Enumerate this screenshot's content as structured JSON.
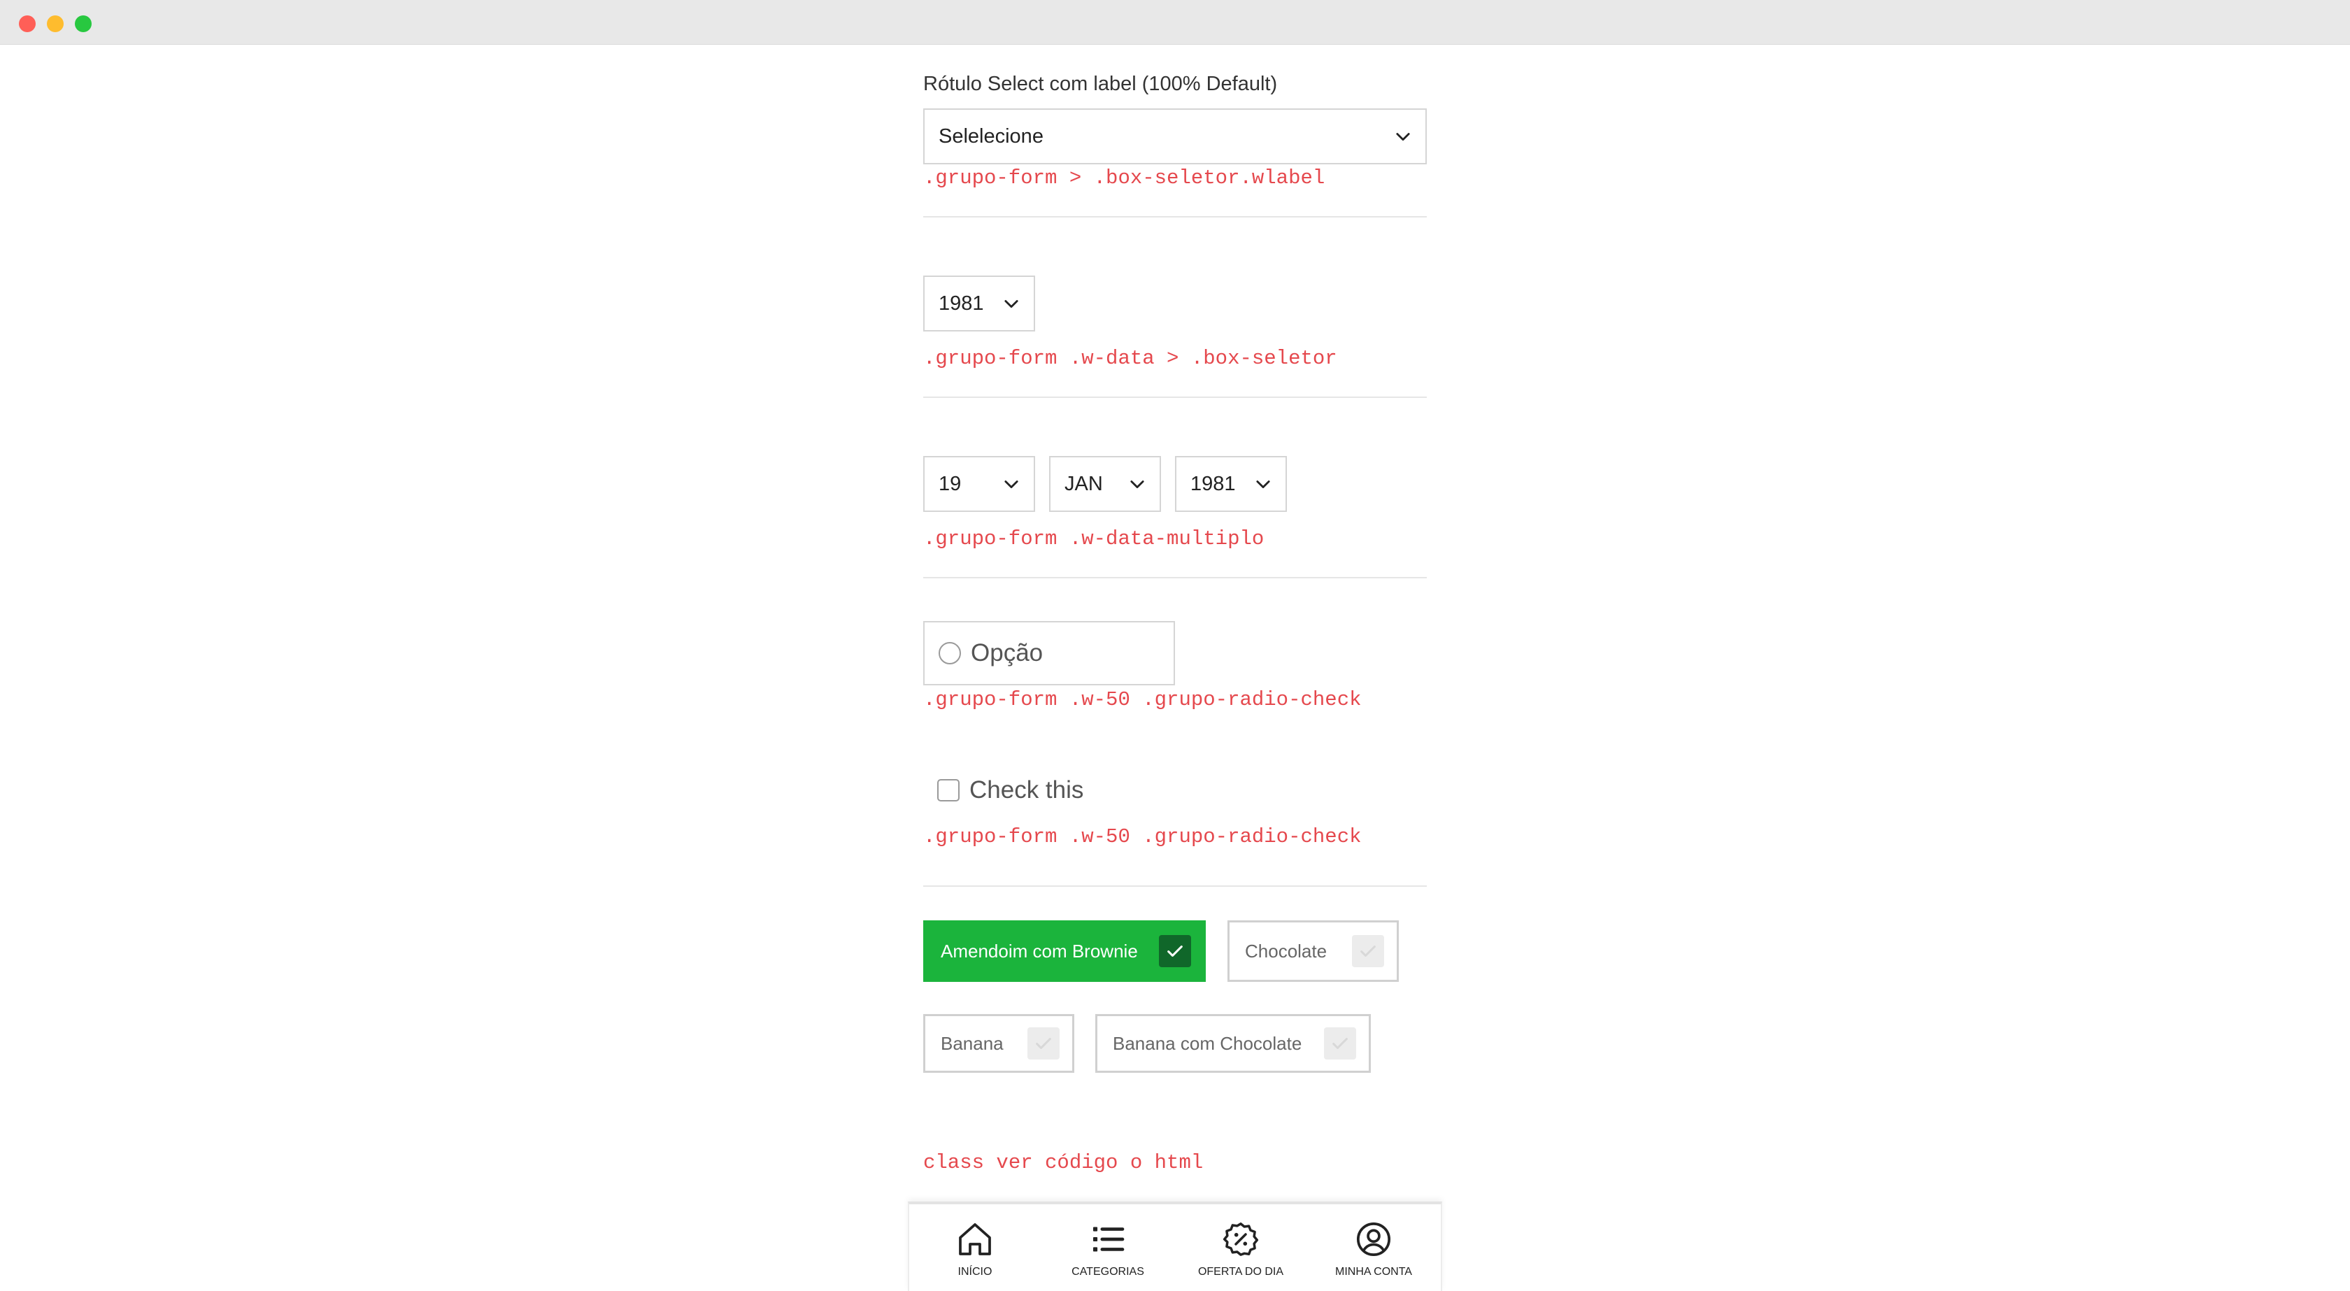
{
  "select_label": {
    "label": "Rótulo Select com label (100% Default)",
    "value": "Selelecione",
    "code": ".grupo-form > .box-seletor.wlabel"
  },
  "year_select": {
    "value": "1981",
    "code": ".grupo-form .w-data > .box-seletor"
  },
  "date_multi": {
    "day": "19",
    "month": "JAN",
    "year": "1981",
    "code": ".grupo-form .w-data-multiplo"
  },
  "radio": {
    "label": "Opção",
    "code": ".grupo-form .w-50 .grupo-radio-check"
  },
  "checkbox": {
    "label": "Check this",
    "code": ".grupo-form .w-50 .grupo-radio-check"
  },
  "chips": {
    "items": [
      {
        "label": "Amendoim com Brownie",
        "checked": true
      },
      {
        "label": "Chocolate",
        "checked": false
      },
      {
        "label": "Banana",
        "checked": false
      },
      {
        "label": "Banana com Chocolate",
        "checked": false
      }
    ],
    "code": "class ver código o html"
  },
  "nav": {
    "items": [
      {
        "label": "INÍCIO",
        "icon": "home-icon"
      },
      {
        "label": "CATEGORIAS",
        "icon": "list-icon"
      },
      {
        "label": "OFERTA DO DIA",
        "icon": "discount-badge-icon"
      },
      {
        "label": "MINHA CONTA",
        "icon": "user-circle-icon"
      }
    ]
  },
  "colors": {
    "accent_green": "#1bb43c",
    "code_red": "#e5484d"
  }
}
